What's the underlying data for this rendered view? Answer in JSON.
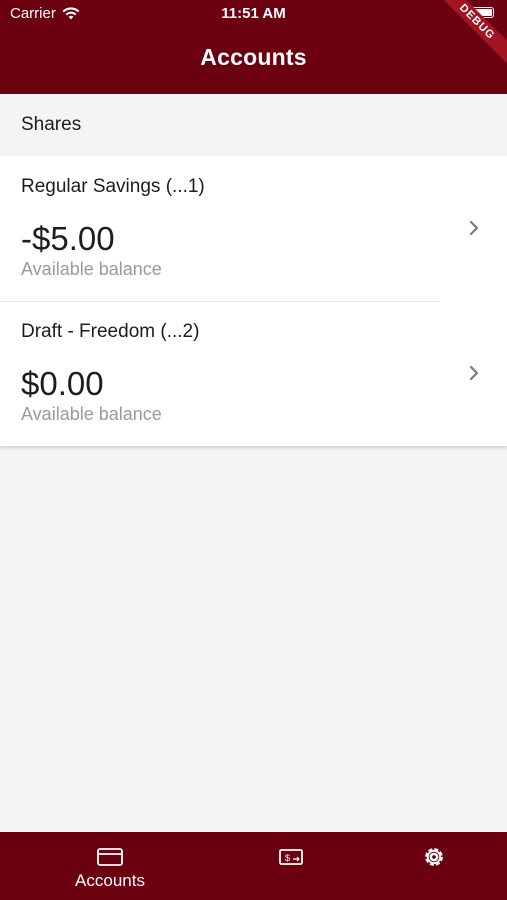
{
  "status_bar": {
    "carrier": "Carrier",
    "time": "11:51 AM"
  },
  "debug_banner": "DEBUG",
  "header": {
    "title": "Accounts"
  },
  "section": {
    "title": "Shares"
  },
  "accounts": [
    {
      "name": "Regular Savings (...1)",
      "balance": "-$5.00",
      "balance_label": "Available balance"
    },
    {
      "name": "Draft - Freedom (...2)",
      "balance": "$0.00",
      "balance_label": "Available balance"
    }
  ],
  "bottom_nav": {
    "items": [
      {
        "label": "Accounts",
        "icon": "card-icon",
        "active": true
      },
      {
        "label": "",
        "icon": "transfer-money-icon",
        "active": false
      },
      {
        "label": "",
        "icon": "gear-icon",
        "active": false
      }
    ]
  },
  "colors": {
    "brand": "#6b0010",
    "background": "#f4f4f4",
    "secondary_text": "#9a9a9a"
  }
}
